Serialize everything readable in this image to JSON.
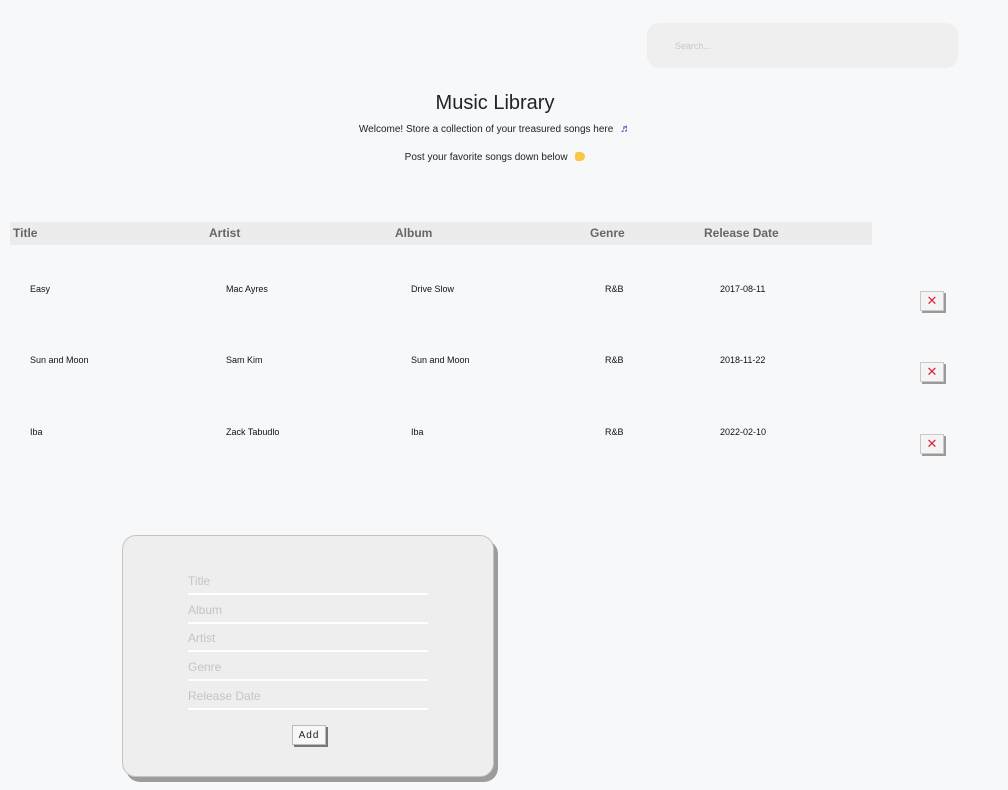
{
  "search": {
    "placeholder": "Search..."
  },
  "header": {
    "title": "Music Library",
    "welcome": "Welcome! Store a collection of your treasured songs here",
    "note_emoji": "♬",
    "post": "Post your favorite songs down below"
  },
  "table": {
    "columns": [
      "Title",
      "Artist",
      "Album",
      "Genre",
      "Release Date"
    ],
    "rows": [
      {
        "title": "Easy",
        "artist": "Mac Ayres",
        "album": "Drive Slow",
        "genre": "R&B",
        "release_date": "2017-08-11",
        "delete_label": "✕"
      },
      {
        "title": "Sun and Moon",
        "artist": "Sam Kim",
        "album": "Sun and Moon",
        "genre": "R&B",
        "release_date": "2018-11-22",
        "delete_label": "✕"
      },
      {
        "title": "Iba",
        "artist": "Zack Tabudlo",
        "album": "Iba",
        "genre": "R&B",
        "release_date": "2022-02-10",
        "delete_label": "✕"
      }
    ]
  },
  "form": {
    "title_placeholder": "Title",
    "album_placeholder": "Album",
    "artist_placeholder": "Artist",
    "genre_placeholder": "Genre",
    "release_date_placeholder": "Release Date",
    "add_label": "Add"
  },
  "colors": {
    "background": "#f7f8fa",
    "delete_icon": "#e0223a",
    "note_emoji": "#4a3fb8",
    "hand_emoji": "#f6c845"
  }
}
